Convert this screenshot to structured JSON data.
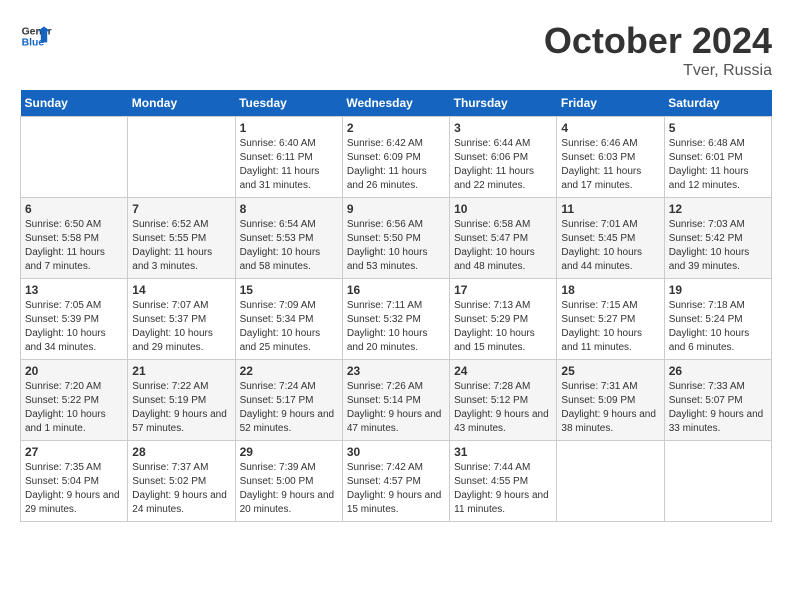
{
  "header": {
    "logo_general": "General",
    "logo_blue": "Blue",
    "month": "October 2024",
    "location": "Tver, Russia"
  },
  "weekdays": [
    "Sunday",
    "Monday",
    "Tuesday",
    "Wednesday",
    "Thursday",
    "Friday",
    "Saturday"
  ],
  "weeks": [
    [
      {
        "day": "",
        "info": ""
      },
      {
        "day": "",
        "info": ""
      },
      {
        "day": "1",
        "info": "Sunrise: 6:40 AM\nSunset: 6:11 PM\nDaylight: 11 hours and 31 minutes."
      },
      {
        "day": "2",
        "info": "Sunrise: 6:42 AM\nSunset: 6:09 PM\nDaylight: 11 hours and 26 minutes."
      },
      {
        "day": "3",
        "info": "Sunrise: 6:44 AM\nSunset: 6:06 PM\nDaylight: 11 hours and 22 minutes."
      },
      {
        "day": "4",
        "info": "Sunrise: 6:46 AM\nSunset: 6:03 PM\nDaylight: 11 hours and 17 minutes."
      },
      {
        "day": "5",
        "info": "Sunrise: 6:48 AM\nSunset: 6:01 PM\nDaylight: 11 hours and 12 minutes."
      }
    ],
    [
      {
        "day": "6",
        "info": "Sunrise: 6:50 AM\nSunset: 5:58 PM\nDaylight: 11 hours and 7 minutes."
      },
      {
        "day": "7",
        "info": "Sunrise: 6:52 AM\nSunset: 5:55 PM\nDaylight: 11 hours and 3 minutes."
      },
      {
        "day": "8",
        "info": "Sunrise: 6:54 AM\nSunset: 5:53 PM\nDaylight: 10 hours and 58 minutes."
      },
      {
        "day": "9",
        "info": "Sunrise: 6:56 AM\nSunset: 5:50 PM\nDaylight: 10 hours and 53 minutes."
      },
      {
        "day": "10",
        "info": "Sunrise: 6:58 AM\nSunset: 5:47 PM\nDaylight: 10 hours and 48 minutes."
      },
      {
        "day": "11",
        "info": "Sunrise: 7:01 AM\nSunset: 5:45 PM\nDaylight: 10 hours and 44 minutes."
      },
      {
        "day": "12",
        "info": "Sunrise: 7:03 AM\nSunset: 5:42 PM\nDaylight: 10 hours and 39 minutes."
      }
    ],
    [
      {
        "day": "13",
        "info": "Sunrise: 7:05 AM\nSunset: 5:39 PM\nDaylight: 10 hours and 34 minutes."
      },
      {
        "day": "14",
        "info": "Sunrise: 7:07 AM\nSunset: 5:37 PM\nDaylight: 10 hours and 29 minutes."
      },
      {
        "day": "15",
        "info": "Sunrise: 7:09 AM\nSunset: 5:34 PM\nDaylight: 10 hours and 25 minutes."
      },
      {
        "day": "16",
        "info": "Sunrise: 7:11 AM\nSunset: 5:32 PM\nDaylight: 10 hours and 20 minutes."
      },
      {
        "day": "17",
        "info": "Sunrise: 7:13 AM\nSunset: 5:29 PM\nDaylight: 10 hours and 15 minutes."
      },
      {
        "day": "18",
        "info": "Sunrise: 7:15 AM\nSunset: 5:27 PM\nDaylight: 10 hours and 11 minutes."
      },
      {
        "day": "19",
        "info": "Sunrise: 7:18 AM\nSunset: 5:24 PM\nDaylight: 10 hours and 6 minutes."
      }
    ],
    [
      {
        "day": "20",
        "info": "Sunrise: 7:20 AM\nSunset: 5:22 PM\nDaylight: 10 hours and 1 minute."
      },
      {
        "day": "21",
        "info": "Sunrise: 7:22 AM\nSunset: 5:19 PM\nDaylight: 9 hours and 57 minutes."
      },
      {
        "day": "22",
        "info": "Sunrise: 7:24 AM\nSunset: 5:17 PM\nDaylight: 9 hours and 52 minutes."
      },
      {
        "day": "23",
        "info": "Sunrise: 7:26 AM\nSunset: 5:14 PM\nDaylight: 9 hours and 47 minutes."
      },
      {
        "day": "24",
        "info": "Sunrise: 7:28 AM\nSunset: 5:12 PM\nDaylight: 9 hours and 43 minutes."
      },
      {
        "day": "25",
        "info": "Sunrise: 7:31 AM\nSunset: 5:09 PM\nDaylight: 9 hours and 38 minutes."
      },
      {
        "day": "26",
        "info": "Sunrise: 7:33 AM\nSunset: 5:07 PM\nDaylight: 9 hours and 33 minutes."
      }
    ],
    [
      {
        "day": "27",
        "info": "Sunrise: 7:35 AM\nSunset: 5:04 PM\nDaylight: 9 hours and 29 minutes."
      },
      {
        "day": "28",
        "info": "Sunrise: 7:37 AM\nSunset: 5:02 PM\nDaylight: 9 hours and 24 minutes."
      },
      {
        "day": "29",
        "info": "Sunrise: 7:39 AM\nSunset: 5:00 PM\nDaylight: 9 hours and 20 minutes."
      },
      {
        "day": "30",
        "info": "Sunrise: 7:42 AM\nSunset: 4:57 PM\nDaylight: 9 hours and 15 minutes."
      },
      {
        "day": "31",
        "info": "Sunrise: 7:44 AM\nSunset: 4:55 PM\nDaylight: 9 hours and 11 minutes."
      },
      {
        "day": "",
        "info": ""
      },
      {
        "day": "",
        "info": ""
      }
    ]
  ]
}
